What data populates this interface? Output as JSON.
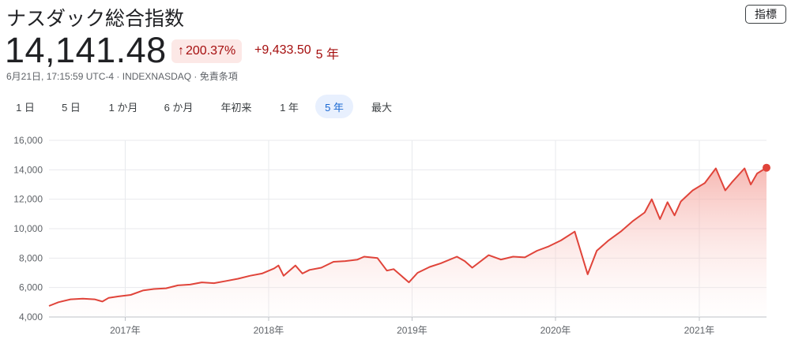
{
  "header": {
    "title": "ナスダック総合指数",
    "indicator_button": "指標",
    "price": "14,141.48",
    "pct_change": "200.37%",
    "abs_change": "+9,433.50",
    "period_label": "5 年",
    "meta": "6月21日, 17:15:59 UTC-4 · INDEXNASDAQ · 免責条項"
  },
  "tabs": [
    {
      "label": "1 日"
    },
    {
      "label": "5 日"
    },
    {
      "label": "1 か月"
    },
    {
      "label": "6 か月"
    },
    {
      "label": "年初来"
    },
    {
      "label": "1 年"
    },
    {
      "label": "5 年",
      "active": true
    },
    {
      "label": "最大"
    }
  ],
  "colors": {
    "line": "#e0443a",
    "fill": "#fbd3cf",
    "grid": "#e8eaed",
    "badge_bg": "#fce8e6",
    "negative_text": "#a50e0e",
    "tab_active_bg": "#e8f0fe",
    "tab_active_text": "#1967d2"
  },
  "chart_data": {
    "type": "area",
    "title": "",
    "xlabel": "",
    "ylabel": "",
    "ylim": [
      4000,
      16000
    ],
    "y_ticks": [
      4000,
      6000,
      8000,
      10000,
      12000,
      14000,
      16000
    ],
    "y_tick_labels": [
      "4,000",
      "6,000",
      "8,000",
      "10,000",
      "12,000",
      "14,000",
      "16,000"
    ],
    "x_ticks": [
      "2017-01-01",
      "2018-01-01",
      "2019-01-01",
      "2020-01-01",
      "2021-01-01"
    ],
    "x_tick_labels": [
      "2017年",
      "2018年",
      "2019年",
      "2020年",
      "2021年"
    ],
    "xlim": [
      "2016-06-21",
      "2021-06-21"
    ],
    "grid": true,
    "series": [
      {
        "points": [
          [
            "2016-06-21",
            4750
          ],
          [
            "2016-07-15",
            5000
          ],
          [
            "2016-08-15",
            5200
          ],
          [
            "2016-09-15",
            5250
          ],
          [
            "2016-10-15",
            5200
          ],
          [
            "2016-11-04",
            5050
          ],
          [
            "2016-11-20",
            5300
          ],
          [
            "2016-12-15",
            5400
          ],
          [
            "2017-01-15",
            5500
          ],
          [
            "2017-02-15",
            5800
          ],
          [
            "2017-03-15",
            5900
          ],
          [
            "2017-04-15",
            5950
          ],
          [
            "2017-05-15",
            6150
          ],
          [
            "2017-06-15",
            6200
          ],
          [
            "2017-07-15",
            6350
          ],
          [
            "2017-08-15",
            6300
          ],
          [
            "2017-09-15",
            6450
          ],
          [
            "2017-10-15",
            6600
          ],
          [
            "2017-11-15",
            6800
          ],
          [
            "2017-12-15",
            6950
          ],
          [
            "2018-01-15",
            7300
          ],
          [
            "2018-01-26",
            7500
          ],
          [
            "2018-02-08",
            6800
          ],
          [
            "2018-03-10",
            7500
          ],
          [
            "2018-03-28",
            6950
          ],
          [
            "2018-04-15",
            7200
          ],
          [
            "2018-05-15",
            7350
          ],
          [
            "2018-06-15",
            7750
          ],
          [
            "2018-07-15",
            7800
          ],
          [
            "2018-08-15",
            7900
          ],
          [
            "2018-09-01",
            8100
          ],
          [
            "2018-10-05",
            8000
          ],
          [
            "2018-10-29",
            7150
          ],
          [
            "2018-11-15",
            7250
          ],
          [
            "2018-12-24",
            6350
          ],
          [
            "2019-01-15",
            7000
          ],
          [
            "2019-02-15",
            7400
          ],
          [
            "2019-03-15",
            7650
          ],
          [
            "2019-04-25",
            8100
          ],
          [
            "2019-05-15",
            7800
          ],
          [
            "2019-06-03",
            7350
          ],
          [
            "2019-07-15",
            8200
          ],
          [
            "2019-08-15",
            7900
          ],
          [
            "2019-09-15",
            8100
          ],
          [
            "2019-10-15",
            8050
          ],
          [
            "2019-11-15",
            8500
          ],
          [
            "2019-12-15",
            8800
          ],
          [
            "2020-01-15",
            9200
          ],
          [
            "2020-02-19",
            9800
          ],
          [
            "2020-03-23",
            6900
          ],
          [
            "2020-04-15",
            8500
          ],
          [
            "2020-05-15",
            9200
          ],
          [
            "2020-06-15",
            9800
          ],
          [
            "2020-07-15",
            10500
          ],
          [
            "2020-08-15",
            11100
          ],
          [
            "2020-09-02",
            12000
          ],
          [
            "2020-09-23",
            10650
          ],
          [
            "2020-10-12",
            11800
          ],
          [
            "2020-10-30",
            10900
          ],
          [
            "2020-11-15",
            11850
          ],
          [
            "2020-12-15",
            12600
          ],
          [
            "2021-01-15",
            13100
          ],
          [
            "2021-02-12",
            14100
          ],
          [
            "2021-03-08",
            12600
          ],
          [
            "2021-03-25",
            13150
          ],
          [
            "2021-04-26",
            14100
          ],
          [
            "2021-05-12",
            13000
          ],
          [
            "2021-05-28",
            13750
          ],
          [
            "2021-06-21",
            14141
          ]
        ]
      }
    ]
  }
}
